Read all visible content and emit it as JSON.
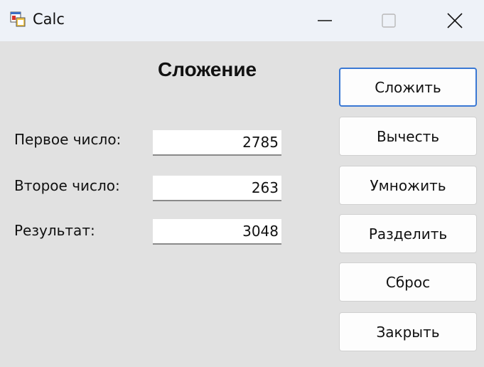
{
  "window": {
    "title": "Calc"
  },
  "titlebar_buttons": [
    "minimize-icon",
    "maximize-icon",
    "close-icon"
  ],
  "operation_title": "Сложение",
  "fields": [
    {
      "label": "Первое число:",
      "value": "2785"
    },
    {
      "label": "Второе число:",
      "value": "263"
    },
    {
      "label": "Результат:",
      "value": "3048"
    }
  ],
  "buttons": [
    {
      "label": "Сложить",
      "default": true
    },
    {
      "label": "Вычесть"
    },
    {
      "label": "Умножить"
    },
    {
      "label": "Разделить"
    },
    {
      "label": "Сброс"
    },
    {
      "label": "Закрыть"
    }
  ],
  "colors": {
    "titlebar_bg": "#eef2f8",
    "client_bg": "#e1e1e1",
    "default_button_border": "#3a78d4"
  }
}
